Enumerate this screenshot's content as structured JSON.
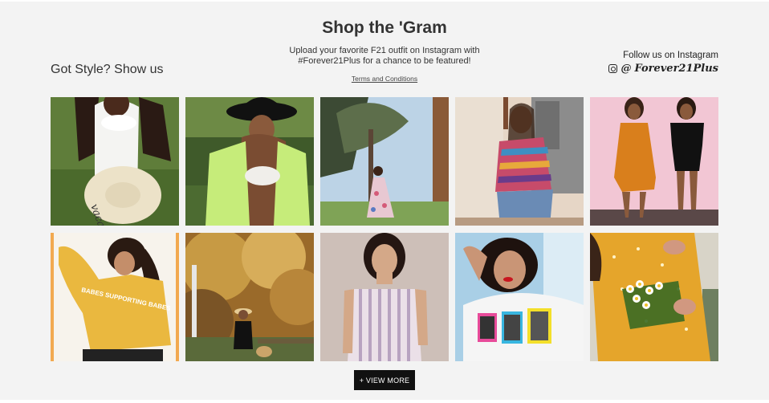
{
  "header": {
    "title": "Shop the 'Gram",
    "left_tagline": "Got Style? Show us",
    "upload_line1": "Upload your favorite F21 outfit on Instagram with",
    "upload_line2": "#Forever21Plus for a chance to be featured!",
    "terms_link": "Terms and Conditions",
    "follow_label": "Follow us on Instagram",
    "at_sign": "@",
    "handle": "Forever21Plus"
  },
  "grid": {
    "photos": [
      {
        "subject": "white-swimsuit-sun-hat",
        "hat_text": "vacay"
      },
      {
        "subject": "green-cardigan-black-hat"
      },
      {
        "subject": "floral-dress-trees"
      },
      {
        "subject": "striped-shirt-denim"
      },
      {
        "subject": "orange-and-black-dresses"
      },
      {
        "subject": "yellow-sweatshirt",
        "shirt_text": "BABES SUPPORTING BABES"
      },
      {
        "subject": "autumn-tree-outfit"
      },
      {
        "subject": "striped-overall-dress"
      },
      {
        "subject": "graphic-tee-red-lips"
      },
      {
        "subject": "yellow-dot-dress-flowers"
      }
    ]
  },
  "actions": {
    "view_more": "+ VIEW MORE"
  }
}
